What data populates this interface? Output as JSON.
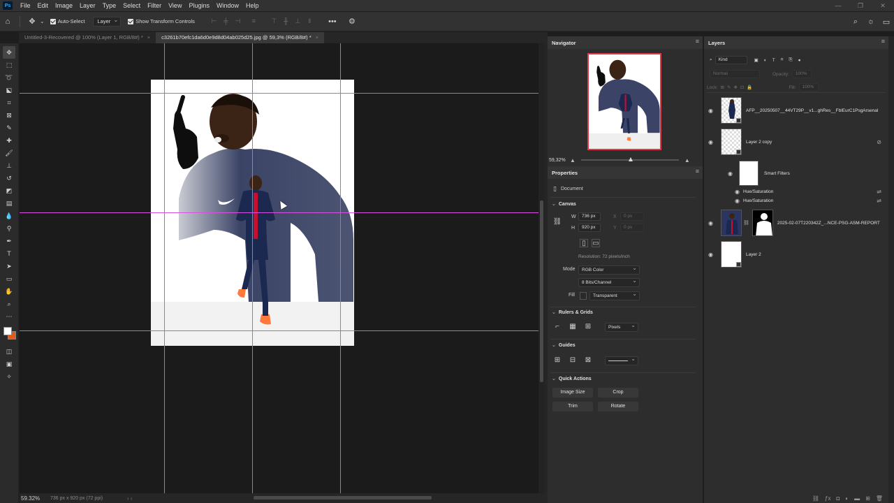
{
  "app": {
    "logo_text": "Ps"
  },
  "menu": [
    "File",
    "Edit",
    "Image",
    "Layer",
    "Type",
    "Select",
    "Filter",
    "View",
    "Plugins",
    "Window",
    "Help"
  ],
  "options_bar": {
    "auto_select_label": "Auto-Select",
    "auto_select_target": "Layer",
    "show_transform_label": "Show Transform Controls",
    "more_label": "•••"
  },
  "tabs": [
    {
      "label": "Untitled-3-Recovered @ 100% (Layer 1, RGB/8#) *",
      "close": "×"
    },
    {
      "label": "c3261b70efc1da6d0e9d8d04ab025d25.jpg @ 59,3% (RGB/8#) *",
      "close": "×"
    }
  ],
  "status": {
    "zoom": "59.32%",
    "doc_info": "736 px x 920 px (72 ppi)",
    "nav_arrows": "›  ‹"
  },
  "navigator": {
    "title": "Navigator",
    "zoom": "59,32%"
  },
  "properties": {
    "title": "Properties",
    "doc_label": "Document",
    "canvas": {
      "title": "Canvas",
      "w_label": "W",
      "w_value": "736 px",
      "h_label": "H",
      "h_value": "920 px",
      "x_label": "X",
      "x_value": "0 px",
      "y_label": "Y",
      "y_value": "0 px",
      "resolution": "Resolution: 72 pixels/inch",
      "mode_label": "Mode",
      "mode_value": "RGB Color",
      "bits_value": "8 Bits/Channel",
      "fill_label": "Fill",
      "fill_value": "Transparent"
    },
    "rulers": {
      "title": "Rulers & Grids",
      "units": "Pixels"
    },
    "guides": {
      "title": "Guides"
    },
    "quick_actions": {
      "title": "Quick Actions",
      "buttons": [
        "Image Size",
        "Crop",
        "Trim",
        "Rotate"
      ]
    }
  },
  "layers": {
    "title": "Layers",
    "filter_kind": "Kind",
    "blend_mode": "Normal",
    "opacity_label": "Opacity:",
    "opacity_value": "100%",
    "lock_label": "Lock:",
    "fill_label": "Fill:",
    "fill_value": "100%",
    "items": [
      {
        "name": "AFP__20250507__44VT29P__v1...ghRes__FblEurC1PsgArsenal"
      },
      {
        "name": "Layer 2 copy"
      },
      {
        "name": "Smart Filters"
      },
      {
        "name": "Hue/Saturation"
      },
      {
        "name": "Hue/Saturation"
      },
      {
        "name": "2025-02-07T220342Z_...NCE-PSG-ASM-REPORT"
      },
      {
        "name": "Layer 2"
      }
    ]
  },
  "colors": {
    "guide": "#d94fe0",
    "foreground": "#ffffff",
    "background": "#e05a1a",
    "navigator_frame": "#e23a4a"
  }
}
